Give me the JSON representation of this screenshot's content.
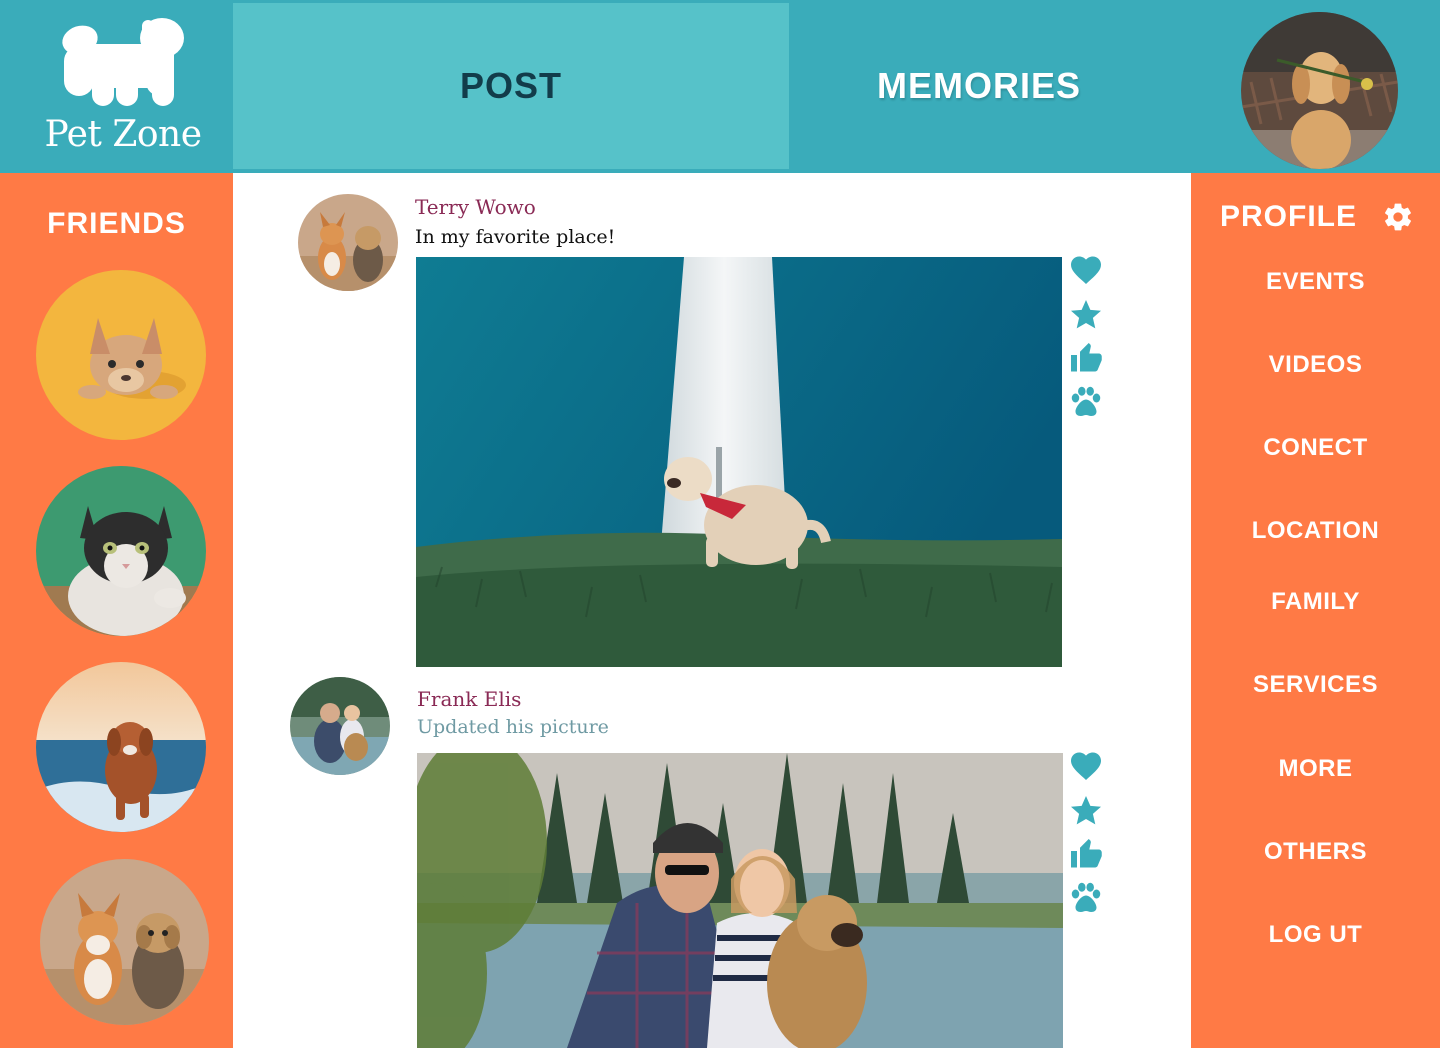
{
  "brand": {
    "name": "Pet Zone",
    "logo_icon": "dog-silhouette-icon"
  },
  "nav": {
    "tabs": [
      {
        "label": "POST",
        "active": true
      },
      {
        "label": "MEMORIES",
        "active": false
      }
    ]
  },
  "friends": {
    "title": "FRIENDS",
    "items": [
      {
        "subject": "french-bulldog"
      },
      {
        "subject": "cat"
      },
      {
        "subject": "dog-at-beach"
      },
      {
        "subject": "corgi-and-yorkie"
      }
    ]
  },
  "profile_menu": {
    "title": "PROFILE",
    "settings_icon": "gear-icon",
    "items": [
      {
        "label": "EVENTS"
      },
      {
        "label": "VIDEOS"
      },
      {
        "label": "CONECT"
      },
      {
        "label": "LOCATION"
      },
      {
        "label": "FAMILY"
      },
      {
        "label": "SERVICES"
      },
      {
        "label": "MORE"
      },
      {
        "label": "OTHERS"
      },
      {
        "label": "LOG UT"
      }
    ]
  },
  "posts": [
    {
      "author": "Terry Wowo",
      "text": "In my favorite place!",
      "reactions": [
        "heart-icon",
        "star-icon",
        "thumbs-up-icon",
        "paw-icon"
      ]
    },
    {
      "author": "Frank Elis",
      "text": "Updated his picture",
      "reactions": [
        "heart-icon",
        "star-icon",
        "thumbs-up-icon",
        "paw-icon"
      ]
    }
  ],
  "colors": {
    "header": "#3aacba",
    "active_tab": "#56c2c9",
    "sidebar": "#ff7a45",
    "author": "#8a2a55",
    "reaction": "#3aacba"
  }
}
